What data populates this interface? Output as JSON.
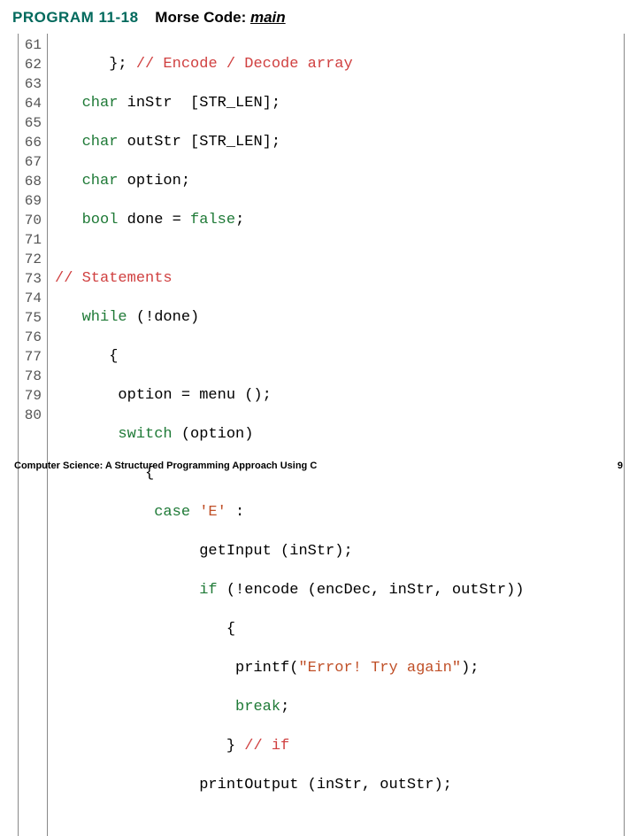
{
  "header": {
    "program_label": "PROGRAM 11-18",
    "title_prefix": "Morse Code: ",
    "title_main": "main"
  },
  "gutter": [
    "61",
    "62",
    "63",
    "64",
    "65",
    "66",
    "67",
    "68",
    "69",
    "70",
    "71",
    "72",
    "73",
    "74",
    "75",
    "76",
    "77",
    "78",
    "79",
    "80"
  ],
  "code": {
    "l61_a": "      }; ",
    "l61_c": "// Encode / Decode array",
    "l62_a": "   ",
    "l62_k": "char",
    "l62_b": " inStr  [STR_LEN];",
    "l63_a": "   ",
    "l63_k": "char",
    "l63_b": " outStr [STR_LEN];",
    "l64_a": "   ",
    "l64_k": "char",
    "l64_b": " option;",
    "l65_a": "   ",
    "l65_k1": "bool",
    "l65_b": " done = ",
    "l65_k2": "false",
    "l65_c": ";",
    "l66": "",
    "l67_c": "// Statements",
    "l68_a": "   ",
    "l68_k": "while",
    "l68_b": " (!done)",
    "l69": "      {",
    "l70": "       option = menu ();",
    "l71_a": "       ",
    "l71_k": "switch",
    "l71_b": " (option)",
    "l72": "          {",
    "l73_a": "           ",
    "l73_k": "case",
    "l73_b": " ",
    "l73_ch": "'E'",
    "l73_c": " :",
    "l74": "                getInput (inStr);",
    "l75_a": "                ",
    "l75_k": "if",
    "l75_b": " (!encode (encDec, inStr, outStr))",
    "l76": "                   {",
    "l77_a": "                    printf(",
    "l77_s": "\"Error! Try again\"",
    "l77_b": ");",
    "l78_a": "                    ",
    "l78_k": "break",
    "l78_b": ";",
    "l79_a": "                   } ",
    "l79_c": "// if",
    "l80": "                printOutput (inStr, outStr);"
  },
  "footer": {
    "left": "Computer Science: A Structured Programming Approach Using C",
    "right": "9"
  }
}
